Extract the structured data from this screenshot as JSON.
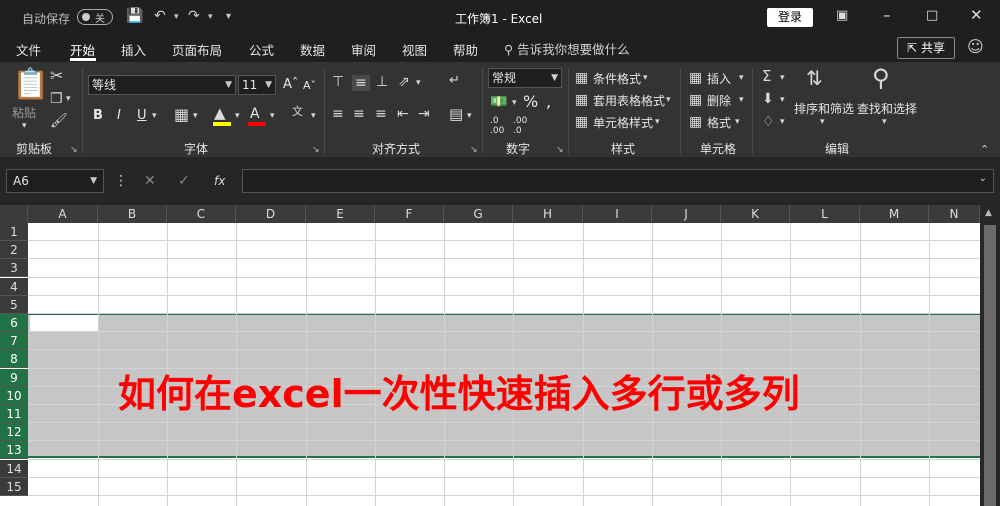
{
  "titlebar": {
    "autosave_label": "自动保存",
    "autosave_state": "关",
    "title": "工作簿1  -  Excel",
    "login_label": "登录"
  },
  "menu": {
    "tabs": [
      "文件",
      "开始",
      "插入",
      "页面布局",
      "公式",
      "数据",
      "审阅",
      "视图",
      "帮助"
    ],
    "active_tab": "开始",
    "tell_me": "告诉我你想要做什么",
    "share_label": "共享"
  },
  "ribbon": {
    "clipboard": {
      "paste": "粘贴",
      "label": "剪贴板"
    },
    "font": {
      "name": "等线",
      "size": "11",
      "bold": "B",
      "italic": "I",
      "underline": "U",
      "label": "字体"
    },
    "alignment": {
      "label": "对齐方式"
    },
    "number": {
      "format": "常规",
      "label": "数字"
    },
    "styles": {
      "conditional": "条件格式",
      "table": "套用表格格式",
      "cell": "单元格样式",
      "label": "样式"
    },
    "cells": {
      "insert": "插入",
      "delete": "删除",
      "format": "格式",
      "label": "单元格"
    },
    "editing": {
      "sort": "排序和筛选",
      "find": "查找和选择",
      "label": "编辑"
    }
  },
  "formula_bar": {
    "name_box": "A6",
    "fx": "fx",
    "content": ""
  },
  "sheet": {
    "columns": [
      "A",
      "B",
      "C",
      "D",
      "E",
      "F",
      "G",
      "H",
      "I",
      "J",
      "K",
      "L",
      "M",
      "N"
    ],
    "rows": [
      "1",
      "2",
      "3",
      "4",
      "5",
      "6",
      "7",
      "8",
      "9",
      "10",
      "11",
      "12",
      "13",
      "14",
      "15"
    ],
    "selected_rows": [
      "6",
      "7",
      "8",
      "9",
      "10",
      "11",
      "12",
      "13"
    ],
    "overlay_text": "如何在excel一次性快速插入多行或多列"
  },
  "colors": {
    "accent": "#217346",
    "overlay": "#ff0000",
    "selection": "#c6c6c6"
  }
}
